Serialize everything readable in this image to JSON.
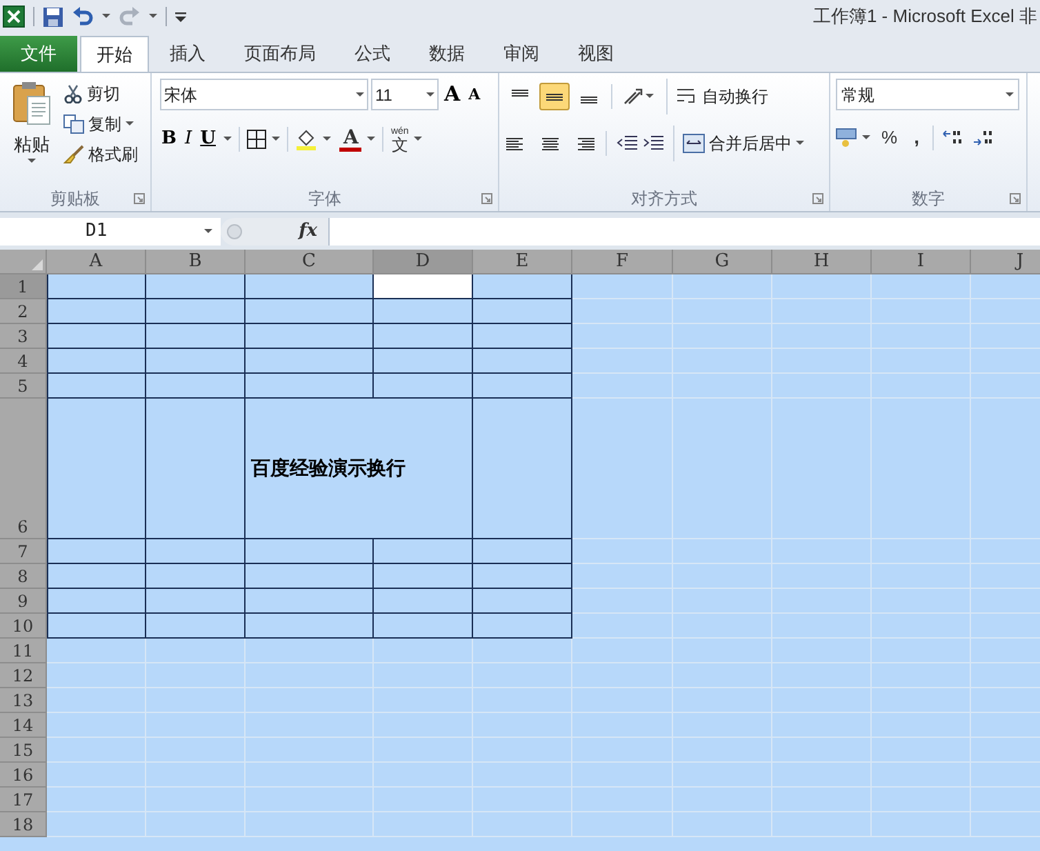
{
  "window": {
    "title": "工作簿1 - Microsoft Excel 非"
  },
  "tabs": [
    {
      "label": "文件",
      "kind": "file",
      "selected": false
    },
    {
      "label": "开始",
      "kind": "normal",
      "selected": true
    },
    {
      "label": "插入",
      "kind": "normal",
      "selected": false
    },
    {
      "label": "页面布局",
      "kind": "normal",
      "selected": false
    },
    {
      "label": "公式",
      "kind": "normal",
      "selected": false
    },
    {
      "label": "数据",
      "kind": "normal",
      "selected": false
    },
    {
      "label": "审阅",
      "kind": "normal",
      "selected": false
    },
    {
      "label": "视图",
      "kind": "normal",
      "selected": false
    }
  ],
  "ribbon": {
    "clipboard": {
      "label": "剪贴板",
      "paste": "粘贴",
      "cut": "剪切",
      "copy": "复制",
      "format_painter": "格式刷"
    },
    "font": {
      "label": "字体",
      "font_name": "宋体",
      "font_size": "11",
      "grow": "A",
      "shrink": "A",
      "bold": "B",
      "italic": "I",
      "underline": "U",
      "font_color": "A",
      "phonetic_top": "wén",
      "phonetic_char": "文"
    },
    "alignment": {
      "label": "对齐方式",
      "vertical": [
        {
          "kind": "top",
          "selected": false
        },
        {
          "kind": "middle",
          "selected": true
        },
        {
          "kind": "bottom",
          "selected": false
        }
      ],
      "wrap_text": "自动换行",
      "merge_center": "合并后居中"
    },
    "number": {
      "label": "数字",
      "format": "常规",
      "percent": "%",
      "comma": ","
    }
  },
  "formula_bar": {
    "name_box": "D1",
    "fx": "fx"
  },
  "sheet": {
    "all_selected": true,
    "columns": [
      {
        "label": "A",
        "active": false
      },
      {
        "label": "B",
        "active": false
      },
      {
        "label": "C",
        "active": false
      },
      {
        "label": "D",
        "active": true
      },
      {
        "label": "E",
        "active": false
      },
      {
        "label": "F",
        "active": false
      },
      {
        "label": "G",
        "active": false
      },
      {
        "label": "H",
        "active": false
      },
      {
        "label": "I",
        "active": false
      },
      {
        "label": "J",
        "active": false
      }
    ],
    "rows": [
      {
        "label": "1",
        "bordered": true,
        "active": true
      },
      {
        "label": "2",
        "bordered": true,
        "active": false
      },
      {
        "label": "3",
        "bordered": true,
        "active": false
      },
      {
        "label": "4",
        "bordered": true,
        "active": false
      },
      {
        "label": "5",
        "bordered": true,
        "active": false
      },
      {
        "label": "6",
        "bordered": true,
        "active": false,
        "merged_text": "百度经验演示换行"
      },
      {
        "label": "7",
        "bordered": true,
        "active": false
      },
      {
        "label": "8",
        "bordered": true,
        "active": false
      },
      {
        "label": "9",
        "bordered": true,
        "active": false
      },
      {
        "label": "10",
        "bordered": true,
        "active": false
      },
      {
        "label": "11",
        "bordered": false,
        "active": false
      },
      {
        "label": "12",
        "bordered": false,
        "active": false
      },
      {
        "label": "13",
        "bordered": false,
        "active": false
      },
      {
        "label": "14",
        "bordered": false,
        "active": false
      },
      {
        "label": "15",
        "bordered": false,
        "active": false
      },
      {
        "label": "16",
        "bordered": false,
        "active": false
      },
      {
        "label": "17",
        "bordered": false,
        "active": false
      },
      {
        "label": "18",
        "bordered": false,
        "active": false
      }
    ]
  }
}
